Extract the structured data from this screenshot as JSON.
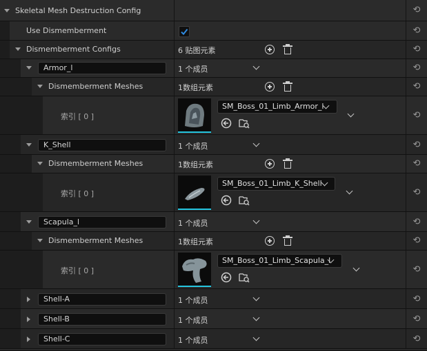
{
  "header": {
    "title": "Skeletal Mesh Destruction Config"
  },
  "use_dismemberment": {
    "label": "Use Dismemberment",
    "checked": true
  },
  "configs": {
    "label": "Dismemberment Configs",
    "count": "6 贴图元素"
  },
  "entries": [
    {
      "name": "Armor_l",
      "members": "1 个成员",
      "meshes_label": "Dismemberment Meshes",
      "meshes_count": "1数组元素",
      "index_label": "索引 [ 0 ]",
      "asset": "SM_Boss_01_Limb_Armor_l"
    },
    {
      "name": "K_Shell",
      "members": "1 个成员",
      "meshes_label": "Dismemberment Meshes",
      "meshes_count": "1数组元素",
      "index_label": "索引 [ 0 ]",
      "asset": "SM_Boss_01_Limb_K_Shell"
    },
    {
      "name": "Scapula_l",
      "members": "1 个成员",
      "meshes_label": "Dismemberment Meshes",
      "meshes_count": "1数组元素",
      "index_label": "索引 [ 0 ]",
      "asset": "SM_Boss_01_Limb_Scapula_l"
    }
  ],
  "collapsed_entries": [
    {
      "name": "Shell-A",
      "members": "1 个成员"
    },
    {
      "name": "Shell-B",
      "members": "1 个成员"
    },
    {
      "name": "Shell-C",
      "members": "1 个成员"
    }
  ],
  "icons": {
    "reset": "reset-arrow-icon",
    "add": "plus-circle-icon",
    "delete": "trash-icon",
    "browse": "browse-arrow-icon",
    "find": "folder-search-icon"
  },
  "colors": {
    "accent": "#25c6e0",
    "checkbox": "#2f8ae0"
  }
}
